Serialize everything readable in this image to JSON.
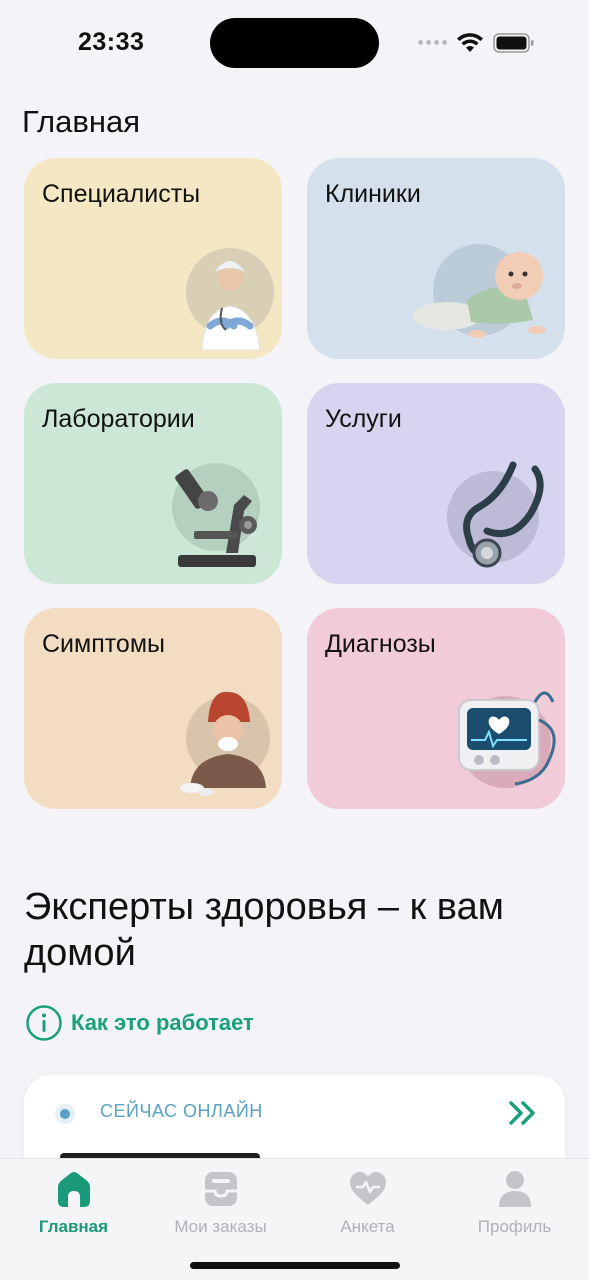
{
  "status": {
    "time": "23:33"
  },
  "page": {
    "title": "Главная"
  },
  "categories": [
    {
      "label": "Специалисты",
      "icon": "doctor-photo"
    },
    {
      "label": "Клиники",
      "icon": "baby-photo"
    },
    {
      "label": "Лаборатории",
      "icon": "microscope-photo"
    },
    {
      "label": "Услуги",
      "icon": "stethoscope-photo"
    },
    {
      "label": "Симптомы",
      "icon": "sick-person-photo"
    },
    {
      "label": "Диагнозы",
      "icon": "heart-monitor-photo"
    }
  ],
  "promo": {
    "headline": "Эксперты здоровья – к вам домой",
    "how_link": "Как это работает"
  },
  "online": {
    "label": "СЕЙЧАС ОНЛАЙН"
  },
  "tabs": [
    {
      "label": "Главная",
      "icon": "home-icon",
      "active": true
    },
    {
      "label": "Мои заказы",
      "icon": "orders-icon",
      "active": false
    },
    {
      "label": "Анкета",
      "icon": "heart-icon",
      "active": false
    },
    {
      "label": "Профиль",
      "icon": "profile-icon",
      "active": false
    }
  ],
  "colors": {
    "accent": "#1a9a78",
    "online_text": "#5aa2c4",
    "card_specialists": "#f3e8c3",
    "card_clinics": "#d4e1ec",
    "card_labs": "#cce7d6",
    "card_services": "#d7d4f0",
    "card_symptoms": "#f2dcc2",
    "card_diagnoses": "#f2cbd8"
  }
}
